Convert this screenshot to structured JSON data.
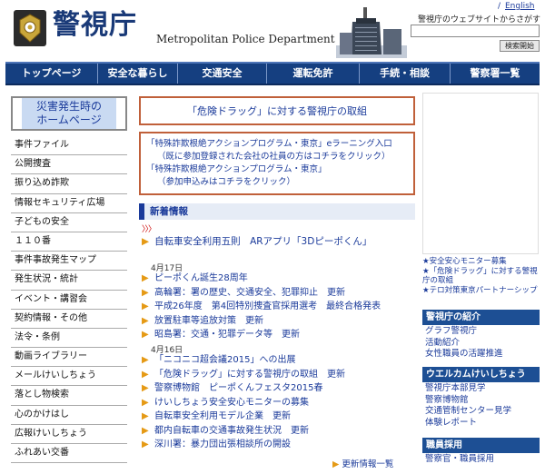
{
  "header": {
    "logo_jp": "警視庁",
    "logo_en": "Metropolitan Police Department",
    "english_link": "English",
    "search_label": "警視庁のウェブサイトからさがす",
    "search_placeholder": "",
    "search_button": "検索開始"
  },
  "global_nav": [
    {
      "label": "トップページ"
    },
    {
      "label": "安全な暮らし"
    },
    {
      "label": "交通安全"
    },
    {
      "label": "運転免許"
    },
    {
      "label": "手続・相談"
    },
    {
      "label": "警察署一覧"
    }
  ],
  "sidebar": {
    "disaster_banner": [
      "災害発生時の",
      "ホームページ"
    ],
    "menu": [
      "事件ファイル",
      "公開捜査",
      "振り込め詐欺",
      "情報セキュリティ広場",
      "子どもの安全",
      "１１０番",
      "事件事故発生マップ",
      "発生状況・統計",
      "イベント・講習会",
      "契約情報・その他",
      "法令・条例",
      "動画ライブラリー",
      "メールけいしちょう",
      "落とし物検索",
      "心のかけはし",
      "広報けいしちょう",
      "ふれあい交番"
    ]
  },
  "main": {
    "drug_banner": "「危険ドラッグ」に対する警視庁の取組",
    "fraud_box": [
      "「特殊詐欺根絶アクションプログラム・東京」eラーニング入口",
      "（既に参加登録された会社の社員の方はコチラをクリック）",
      "「特殊詐欺根絶アクションプログラム・東京」",
      "（参加申込みはコチラをクリック）"
    ],
    "news_heading": "新着情報",
    "chevrons": "〉〉〉",
    "featured": "自転車安全利用五則　ARアプリ「3Dピーポくん」",
    "groups": [
      {
        "date": "4月17日",
        "items": [
          "ピーポくん誕生28周年",
          "高輪署：署の歴史、交通安全、犯罪抑止　更新",
          "平成26年度　第4回特別捜査官採用選考　最終合格発表",
          "放置駐車等追放対策　更新",
          "昭島署：交通・犯罪データ等　更新"
        ]
      },
      {
        "date": "4月16日",
        "items": [
          "「ニコニコ超会議2015」への出展",
          "「危険ドラッグ」に対する警視庁の取組　更新",
          "警察博物館　ピーポくんフェスタ2015春",
          "けいしちょう安全安心モニターの募集",
          "自転車安全利用モデル企業　更新",
          "都内自転車の交通事故発生状況　更新",
          "深川署：暴力団出張相談所の開設"
        ]
      }
    ],
    "more_news": "更新情報一覧"
  },
  "right": {
    "links": [
      "安全安心モニター募集",
      "「危険ドラッグ」に対する警視庁の取組",
      "テロ対策東京パートナーシップ"
    ],
    "sections": [
      {
        "title": "警視庁の紹介",
        "items": [
          "グラフ警視庁",
          "活動紹介",
          "女性職員の活躍推進"
        ]
      },
      {
        "title": "ウエルカムけいしちょう",
        "items": [
          "警視庁本部見学",
          "警察博物館",
          "交通管制センター見学",
          "体験レポート"
        ]
      },
      {
        "title": "職員採用",
        "items": [
          "警察官・職員採用"
        ]
      }
    ]
  },
  "colors": {
    "nav_blue": "#153f80",
    "link_blue": "#1a3a9a",
    "box_border": "#c0603a",
    "bullet_orange": "#e59a15"
  }
}
